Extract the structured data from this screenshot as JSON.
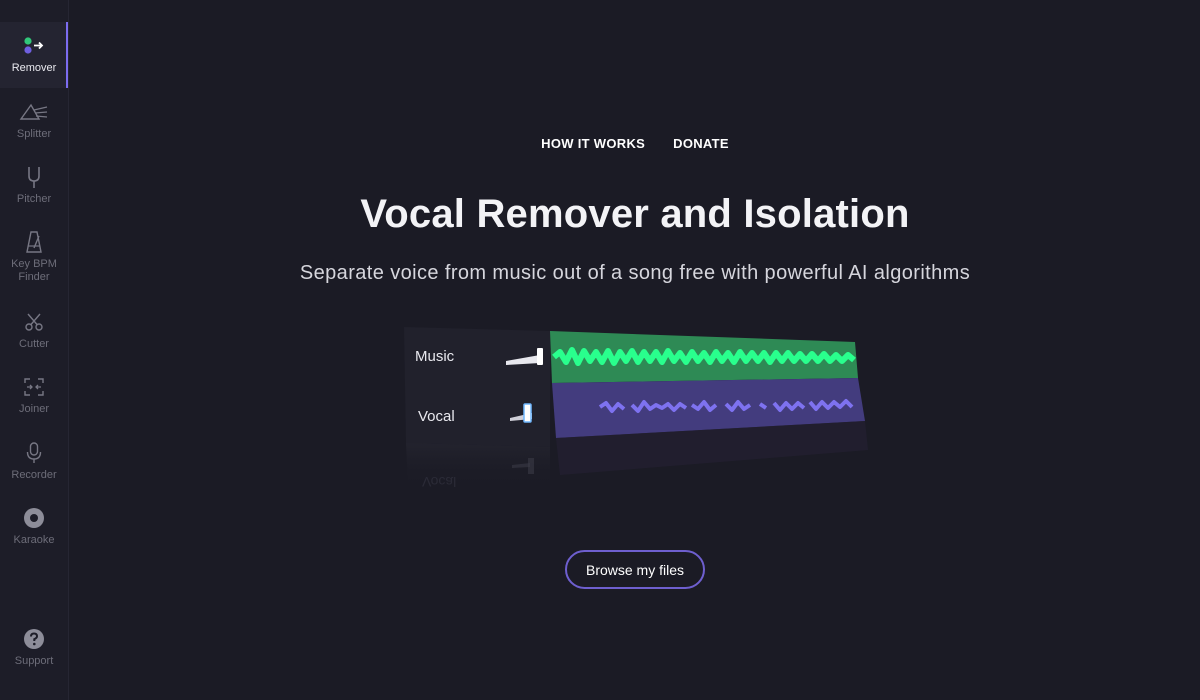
{
  "sidebar": {
    "items": [
      {
        "label": "Remover",
        "icon": "remover-icon",
        "active": true
      },
      {
        "label": "Splitter",
        "icon": "splitter-icon"
      },
      {
        "label": "Pitcher",
        "icon": "tuning-fork-icon"
      },
      {
        "label": "Key BPM Finder",
        "icon": "metronome-icon"
      },
      {
        "label": "Cutter",
        "icon": "scissors-icon"
      },
      {
        "label": "Joiner",
        "icon": "joiner-icon"
      },
      {
        "label": "Recorder",
        "icon": "microphone-icon"
      },
      {
        "label": "Karaoke",
        "icon": "disc-icon"
      }
    ],
    "support": {
      "label": "Support",
      "icon": "question-icon"
    }
  },
  "nav": {
    "how_it_works": "HOW IT WORKS",
    "donate": "DONATE"
  },
  "hero": {
    "title": "Vocal Remover and Isolation",
    "subtitle": "Separate voice from music out of a song free with powerful AI algorithms"
  },
  "illustration": {
    "music_label": "Music",
    "vocal_label": "Vocal",
    "music_color": "#1fe07a",
    "vocal_color": "#6a5fd8"
  },
  "browse_button": "Browse my files",
  "colors": {
    "background": "#1b1b25",
    "accent": "#7c6cf0"
  }
}
